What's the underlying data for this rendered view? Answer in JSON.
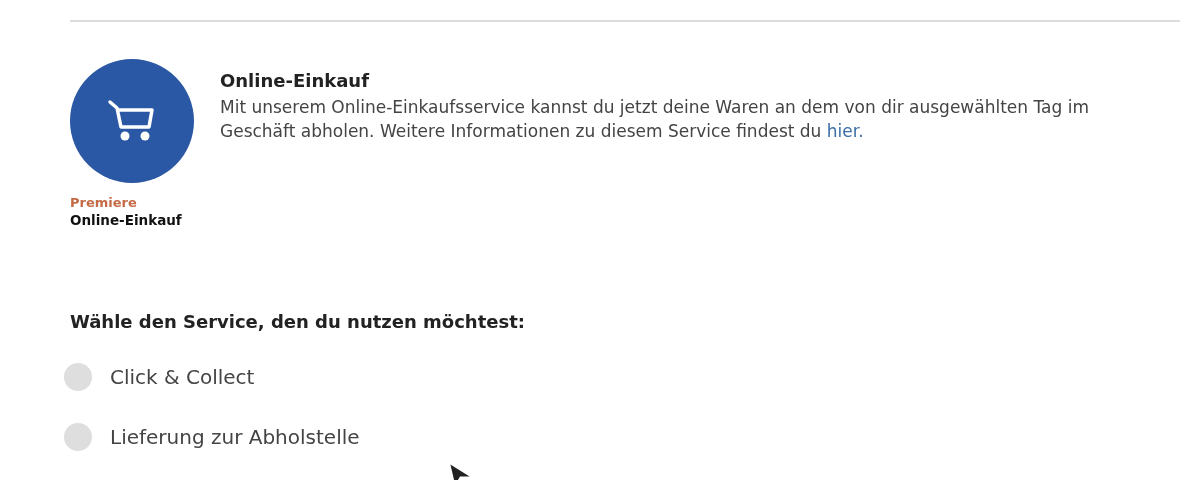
{
  "service": {
    "title": "Online-Einkauf",
    "description": "Mit unserem Online-Einkaufsservice kannst du jetzt deine Waren an dem von dir ausgewählten Tag im Geschäft abholen. Weitere Informationen zu diesem Service findest du",
    "link": "hier.",
    "badge_kicker": "Premiere",
    "badge_name": "Online-Einkauf"
  },
  "choice": {
    "heading": "Wähle den Service, den du nutzen möchtest:",
    "options": [
      {
        "label": "Click & Collect",
        "selected": false
      },
      {
        "label": "Lieferung zur Abholstelle",
        "selected": false
      }
    ]
  }
}
